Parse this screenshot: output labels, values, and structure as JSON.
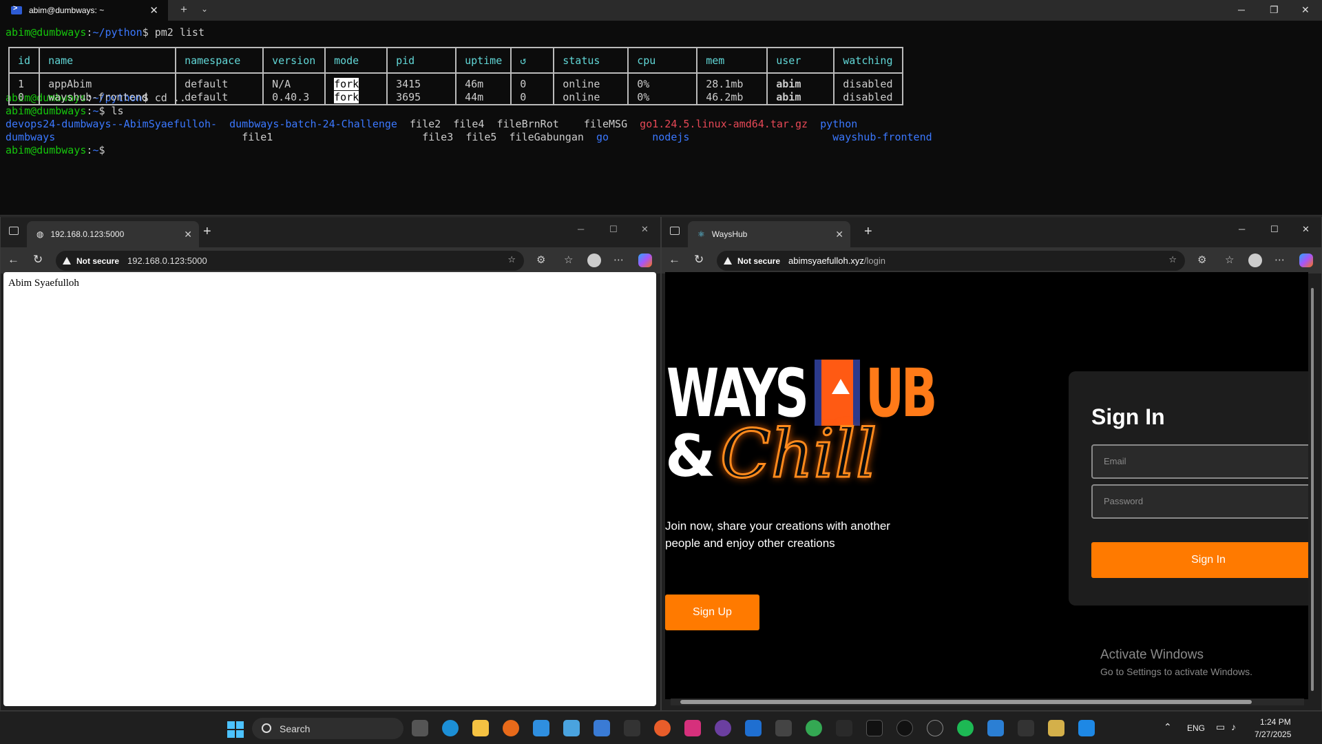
{
  "terminal": {
    "tab_title": "abim@dumbways: ~",
    "prompt_user": "abim@dumbways",
    "cwd_python": "~/python",
    "cwd_home": "~",
    "cmd1": "pm2 list",
    "cmd2": "cd ..",
    "cmd3": "ls",
    "pm2": {
      "headers": [
        "id",
        "name",
        "namespace",
        "version",
        "mode",
        "pid",
        "uptime",
        "↺",
        "status",
        "cpu",
        "mem",
        "user",
        "watching"
      ],
      "rows": [
        {
          "id": "1",
          "name": "appAbim",
          "namespace": "default",
          "version": "N/A",
          "mode": "fork",
          "pid": "3415",
          "uptime": "46m",
          "restarts": "0",
          "status": "online",
          "cpu": "0%",
          "mem": "28.1mb",
          "user": "abim",
          "watching": "disabled"
        },
        {
          "id": "0",
          "name": "wayshub-frontend",
          "namespace": "default",
          "version": "0.40.3",
          "mode": "fork",
          "pid": "3695",
          "uptime": "44m",
          "restarts": "0",
          "status": "online",
          "cpu": "0%",
          "mem": "46.2mb",
          "user": "abim",
          "watching": "disabled"
        }
      ]
    },
    "ls": {
      "dir1a": "devops24-dumbways--AbimSyaefulloh-",
      "dir1b": "dumbways",
      "dir2": "dumbways-batch-24-Challenge",
      "f1": "file1",
      "f2": "file2",
      "f3": "file3",
      "f4": "file4",
      "f5": "file5",
      "fbr": "fileBrnRot",
      "fgab": "fileGabungan",
      "fmsg": "fileMSG",
      "go": "go",
      "tar": "go1.24.5.linux-amd64.tar.gz",
      "nodejs": "nodejs",
      "python": "python",
      "wf": "wayshub-frontend"
    }
  },
  "browser1": {
    "tab_title": "192.168.0.123:5000",
    "not_secure": "Not secure",
    "url": "192.168.0.123:5000",
    "page_text": "Abim Syaefulloh"
  },
  "browser2": {
    "tab_title": "WaysHub",
    "not_secure": "Not secure",
    "url_host": "abimsyaefulloh.xyz",
    "url_path": "/login",
    "logo_ways": "WAYS",
    "logo_ub": "UB",
    "logo_amp": "&",
    "logo_chill": "Chill",
    "tagline": "Join now, share your creations with another people and enjoy other creations",
    "signup_label": "Sign Up",
    "signin_title": "Sign In",
    "email_placeholder": "Email",
    "password_placeholder": "Password",
    "signin_button": "Sign In",
    "activate_title": "Activate Windows",
    "activate_sub": "Go to Settings to activate Windows."
  },
  "taskbar": {
    "search_label": "Search",
    "lang": "ENG",
    "time": "1:24 PM",
    "date": "7/27/2025"
  }
}
